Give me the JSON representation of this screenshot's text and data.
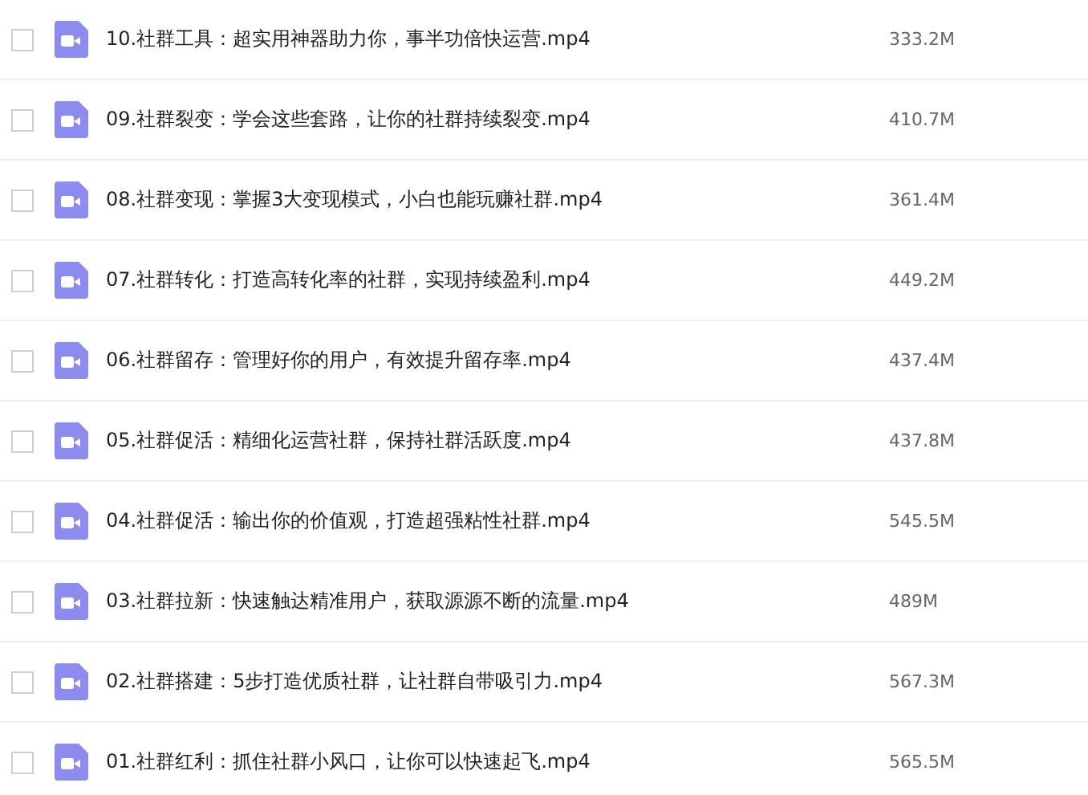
{
  "files": [
    {
      "name": "10.社群工具：超实用神器助力你，事半功倍快运营.mp4",
      "size": "333.2M",
      "checked": false
    },
    {
      "name": "09.社群裂变：学会这些套路，让你的社群持续裂变.mp4",
      "size": "410.7M",
      "checked": false
    },
    {
      "name": "08.社群变现：掌握3大变现模式，小白也能玩赚社群.mp4",
      "size": "361.4M",
      "checked": false
    },
    {
      "name": "07.社群转化：打造高转化率的社群，实现持续盈利.mp4",
      "size": "449.2M",
      "checked": false
    },
    {
      "name": "06.社群留存：管理好你的用户，有效提升留存率.mp4",
      "size": "437.4M",
      "checked": false
    },
    {
      "name": "05.社群促活：精细化运营社群，保持社群活跃度.mp4",
      "size": "437.8M",
      "checked": false
    },
    {
      "name": "04.社群促活：输出你的价值观，打造超强粘性社群.mp4",
      "size": "545.5M",
      "checked": false
    },
    {
      "name": "03.社群拉新：快速触达精准用户，获取源源不断的流量.mp4",
      "size": "489M",
      "checked": false
    },
    {
      "name": "02.社群搭建：5步打造优质社群，让社群自带吸引力.mp4",
      "size": "567.3M",
      "checked": false
    },
    {
      "name": "01.社群红利：抓住社群小风口，让你可以快速起飞.mp4",
      "size": "565.5M",
      "checked": false
    }
  ]
}
